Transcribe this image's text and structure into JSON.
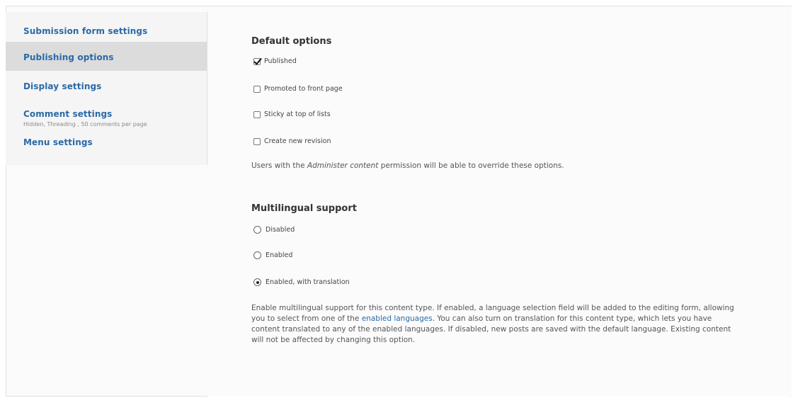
{
  "sidebar": {
    "items": [
      {
        "label": "Submission form settings",
        "summary": ""
      },
      {
        "label": "Publishing options",
        "summary": ""
      },
      {
        "label": "Display settings",
        "summary": ""
      },
      {
        "label": "Comment settings",
        "summary": "Hidden, Threading , 50 comments per page"
      },
      {
        "label": "Menu settings",
        "summary": ""
      }
    ],
    "selected_index": 1
  },
  "default_options": {
    "title": "Default options",
    "checkboxes": [
      {
        "label": "Published",
        "checked": true
      },
      {
        "label": "Promoted to front page",
        "checked": false
      },
      {
        "label": "Sticky at top of lists",
        "checked": false
      },
      {
        "label": "Create new revision",
        "checked": false
      }
    ],
    "description_pre": "Users with the ",
    "description_em": "Administer content",
    "description_post": " permission will be able to override these options."
  },
  "multilingual": {
    "title": "Multilingual support",
    "radios": [
      {
        "label": "Disabled",
        "checked": false
      },
      {
        "label": "Enabled",
        "checked": false
      },
      {
        "label": "Enabled, with translation",
        "checked": true
      }
    ],
    "description_pre": "Enable multilingual support for this content type. If enabled, a language selection field will be added to the editing form, allowing you to select from one of the ",
    "description_link": "enabled languages",
    "description_post": ". You can also turn on translation for this content type, which lets you have content translated to any of the enabled languages. If disabled, new posts are saved with the default language. Existing content will not be affected by changing this option."
  },
  "colors": {
    "link": "#2a6aa6",
    "selected_tab_bg": "#dcdcdc",
    "panel_bg": "#fbfbfb"
  }
}
